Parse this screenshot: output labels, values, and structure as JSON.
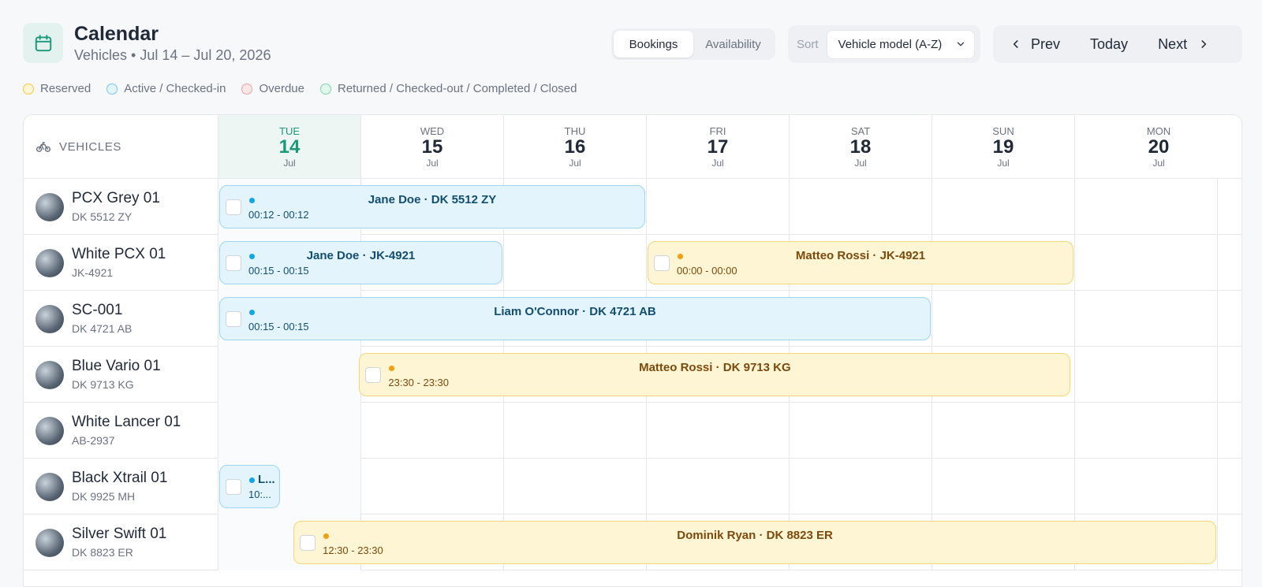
{
  "header": {
    "title": "Calendar",
    "subtitle": "Vehicles • Jul 14 – Jul 20, 2026",
    "view_tabs": [
      {
        "label": "Bookings",
        "active": true
      },
      {
        "label": "Availability",
        "active": false
      }
    ],
    "sort_label": "Sort",
    "sort_value": "Vehicle model (A-Z)",
    "prev_label": "Prev",
    "today_label": "Today",
    "next_label": "Next",
    "accent_color": "#1a9a7a"
  },
  "legend": [
    {
      "label": "Reserved",
      "color": "#f6c945",
      "fill": "#fdf5d3"
    },
    {
      "label": "Active / Checked-in",
      "color": "#7cc6ec",
      "fill": "#e3f4fc"
    },
    {
      "label": "Overdue",
      "color": "#f3a3a3",
      "fill": "#fde6e6"
    },
    {
      "label": "Returned / Checked-out / Completed / Closed",
      "color": "#7fd6ad",
      "fill": "#e3f7ee"
    }
  ],
  "grid": {
    "vehicles_header": "VEHICLES",
    "days": [
      {
        "name": "TUE",
        "num": "14",
        "month": "Jul",
        "today": true
      },
      {
        "name": "WED",
        "num": "15",
        "month": "Jul",
        "today": false
      },
      {
        "name": "THU",
        "num": "16",
        "month": "Jul",
        "today": false
      },
      {
        "name": "FRI",
        "num": "17",
        "month": "Jul",
        "today": false
      },
      {
        "name": "SAT",
        "num": "18",
        "month": "Jul",
        "today": false
      },
      {
        "name": "SUN",
        "num": "19",
        "month": "Jul",
        "today": false
      },
      {
        "name": "MON",
        "num": "20",
        "month": "Jul",
        "today": false
      }
    ],
    "vehicles": [
      {
        "name": "PCX Grey 01",
        "plate": "DK 5512 ZY"
      },
      {
        "name": "White PCX 01",
        "plate": "JK-4921"
      },
      {
        "name": "SC-001",
        "plate": "DK 4721 AB"
      },
      {
        "name": "Blue Vario 01",
        "plate": "DK 9713 KG"
      },
      {
        "name": "White Lancer 01",
        "plate": "AB-2937"
      },
      {
        "name": "Black Xtrail 01",
        "plate": "DK 9925 MH"
      },
      {
        "name": "Silver Swift 01",
        "plate": "DK 8823 ER"
      }
    ]
  },
  "bookings": [
    {
      "row": 0,
      "start_day": 0.0,
      "span_days": 3.0,
      "status": "active",
      "title": "Jane Doe · DK 5512 ZY",
      "time": "00:12 - 00:12"
    },
    {
      "row": 1,
      "start_day": 0.0,
      "span_days": 2.0,
      "status": "active",
      "title": "Jane Doe · JK-4921",
      "time": "00:15 - 00:15"
    },
    {
      "row": 1,
      "start_day": 3.0,
      "span_days": 3.0,
      "status": "reserved",
      "title": "Matteo Rossi · JK-4921",
      "time": "00:00 - 00:00"
    },
    {
      "row": 2,
      "start_day": 0.0,
      "span_days": 5.0,
      "status": "active",
      "title": "Liam O'Connor · DK 4721 AB",
      "time": "00:15 - 00:15"
    },
    {
      "row": 3,
      "start_day": 0.98,
      "span_days": 5.0,
      "status": "reserved",
      "title": "Matteo Rossi · DK 9713 KG",
      "time": "23:30 - 23:30"
    },
    {
      "row": 5,
      "start_day": 0.0,
      "span_days": 0.44,
      "status": "active",
      "title": "L...",
      "time": "10:...",
      "small": true
    },
    {
      "row": 6,
      "start_day": 0.52,
      "span_days": 6.48,
      "status": "reserved",
      "title": "Dominik Ryan · DK 8823 ER",
      "time": "12:30 - 23:30"
    }
  ]
}
